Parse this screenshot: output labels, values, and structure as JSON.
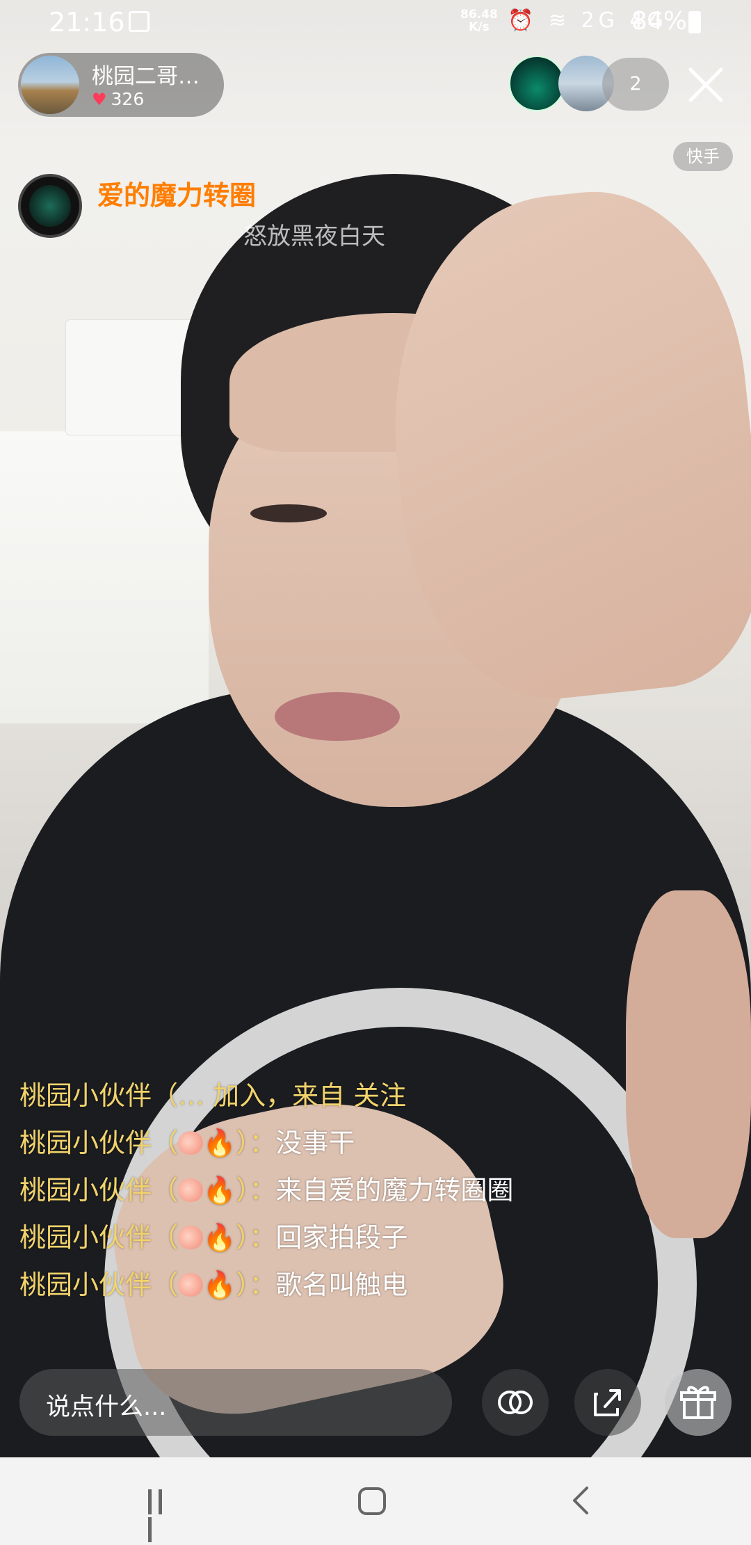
{
  "status_bar": {
    "time": "21:16",
    "net_speed_value": "86.48",
    "net_speed_unit": "K/s",
    "signal_icons": "⏰ ≋ 2G 4G",
    "battery": "84%"
  },
  "host": {
    "name": "桃园二哥…",
    "likes": "326"
  },
  "viewers": {
    "count": "2"
  },
  "platform_badge": "快手",
  "song": {
    "title": "爱的魔力转圈",
    "lyric": "怒放黑夜白天"
  },
  "comments": [
    {
      "user": "桃园小伙伴（… ",
      "text": "加入，来自 关注",
      "type": "join"
    },
    {
      "user": "桃园小伙伴（",
      "badge": true,
      "text": "没事干",
      "type": "msg"
    },
    {
      "user": "桃园小伙伴（",
      "badge": true,
      "text": "来自爱的魔力转圈圈",
      "type": "msg"
    },
    {
      "user": "桃园小伙伴（",
      "badge": true,
      "text": "回家拍段子",
      "type": "msg"
    },
    {
      "user": "桃园小伙伴（",
      "badge": true,
      "text": "歌名叫触电",
      "type": "msg"
    }
  ],
  "comment_badge": {
    "close": "）",
    "sep": "："
  },
  "input": {
    "placeholder": "说点什么..."
  },
  "icons": {
    "close": "close-icon",
    "link": "link-mic-icon",
    "share": "share-icon",
    "gift": "gift-icon"
  },
  "colors": {
    "song_title": "#ff7e00",
    "comment_user": "#f2d36b",
    "heart": "#ff3b5a"
  }
}
